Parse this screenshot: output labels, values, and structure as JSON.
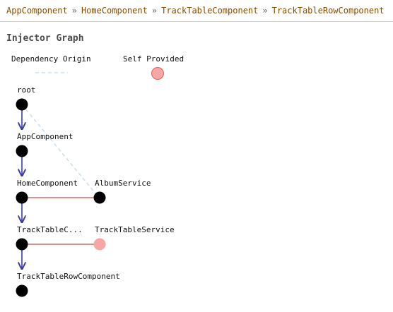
{
  "breadcrumb": {
    "items": [
      "AppComponent",
      "HomeComponent",
      "TrackTableComponent",
      "TrackTableRowComponent"
    ],
    "separator": "»"
  },
  "graph": {
    "title": "Injector Graph",
    "legend": {
      "dependency_origin": "Dependency Origin",
      "self_provided": "Self Provided"
    },
    "nodes": {
      "root": "root",
      "app": "AppComponent",
      "home": "HomeComponent",
      "album": "AlbumService",
      "tracktable": "TrackTableC...",
      "trackservice": "TrackTableService",
      "trackrow": "TrackTableRowComponent"
    }
  },
  "colors": {
    "breadcrumb_text": "#8a4a00",
    "node_fill": "#000000",
    "self_provided_fill": "#f8a5a5",
    "self_provided_stroke": "#e06060",
    "dependency_line": "#c9def2",
    "arrow": "#3a3aa8",
    "provider_link": "#d86a6a"
  }
}
